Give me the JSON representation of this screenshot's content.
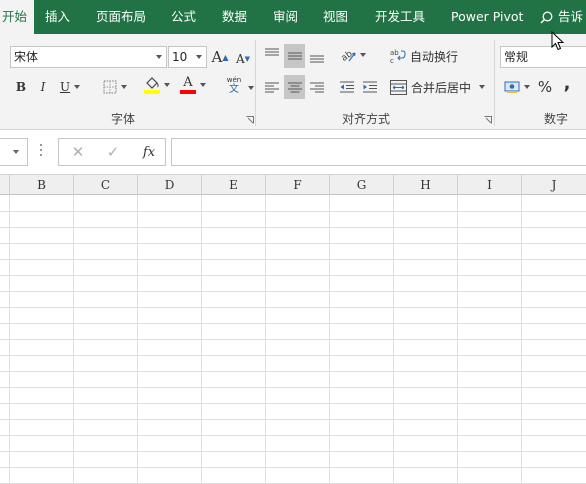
{
  "tabs": {
    "home": "开始",
    "insert": "插入",
    "page_layout": "页面布局",
    "formulas": "公式",
    "data": "数据",
    "review": "审阅",
    "view": "视图",
    "developer": "开发工具",
    "power_pivot": "Power Pivot",
    "tell_me": "告诉"
  },
  "font_group": {
    "label": "字体",
    "font_name": "宋体",
    "font_size": "10",
    "bold": "B",
    "italic": "I",
    "underline": "U",
    "grow": "A",
    "shrink": "A",
    "pinyin_top": "wén",
    "pinyin_bottom": "文",
    "font_color": "A"
  },
  "align_group": {
    "label": "对齐方式",
    "wrap_text": "自动换行",
    "merge_center": "合并后居中"
  },
  "number_group": {
    "label": "数字",
    "format": "常规",
    "percent": "%",
    "comma": ","
  },
  "formula_bar": {
    "cancel": "✕",
    "enter": "✓",
    "fx": "fx"
  },
  "columns": [
    "B",
    "C",
    "D",
    "E",
    "F",
    "G",
    "H",
    "I",
    "J"
  ],
  "colors": {
    "ribbon_green": "#217346",
    "highlight_yellow": "#ffff00",
    "font_red": "#ff0000"
  }
}
